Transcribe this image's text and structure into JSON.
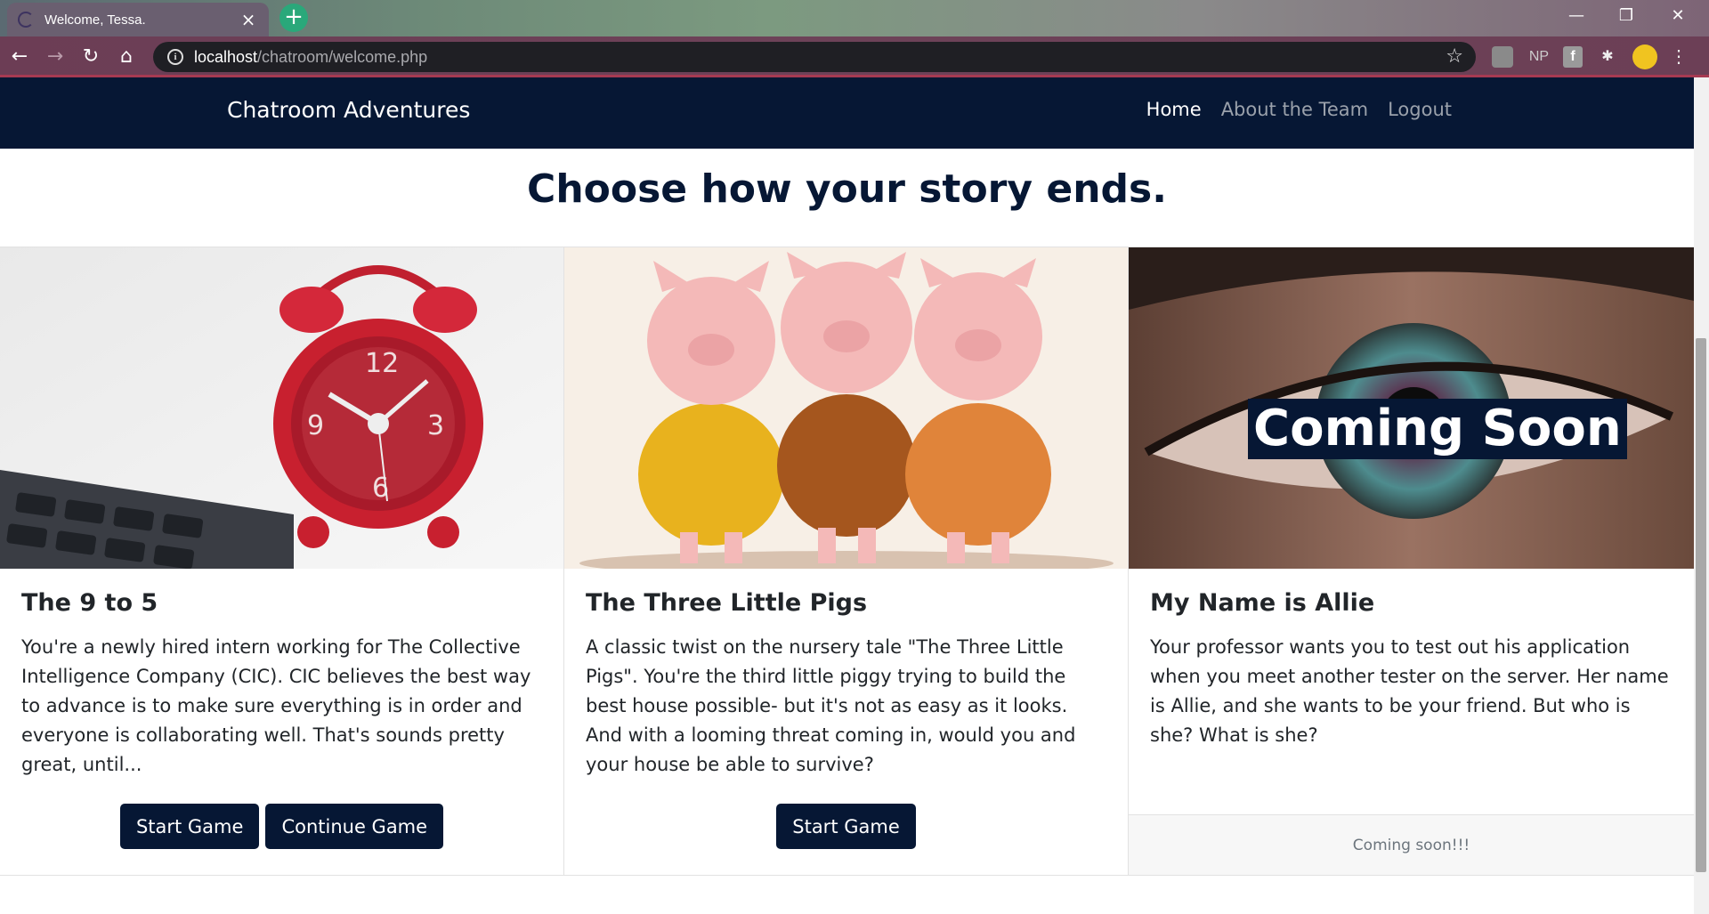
{
  "browser": {
    "tab_title": "Welcome, Tessa.",
    "url_host": "localhost",
    "url_path": "/chatroom/welcome.php",
    "ext_np": "NP"
  },
  "navbar": {
    "brand": "Chatroom Adventures",
    "links": [
      "Home",
      "About the Team",
      "Logout"
    ]
  },
  "heading": "Choose how your story ends.",
  "cards": [
    {
      "title": "The 9 to 5",
      "text": "You're a newly hired intern working for The Collective Intelligence Company (CIC). CIC believes the best way to advance is to make sure everything is in order and everyone is collaborating well. That's sounds pretty great, until...",
      "buttons": [
        "Start Game",
        "Continue Game"
      ]
    },
    {
      "title": "The Three Little Pigs",
      "text": "A classic twist on the nursery tale \"The Three Little Pigs\". You're the third little piggy trying to build the best house possible- but it's not as easy as it looks. And with a looming threat coming in, would you and your house be able to survive?",
      "buttons": [
        "Start Game"
      ]
    },
    {
      "title": "My Name is Allie",
      "text": "Your professor wants you to test out his application when you meet another tester on the server. Her name is Allie, and she wants to be your friend. But who is she? What is she?",
      "overlay": "Coming Soon",
      "footer": "Coming soon!!!"
    }
  ],
  "colors": {
    "navy": "#061734",
    "link_muted": "#9aa1ab"
  }
}
